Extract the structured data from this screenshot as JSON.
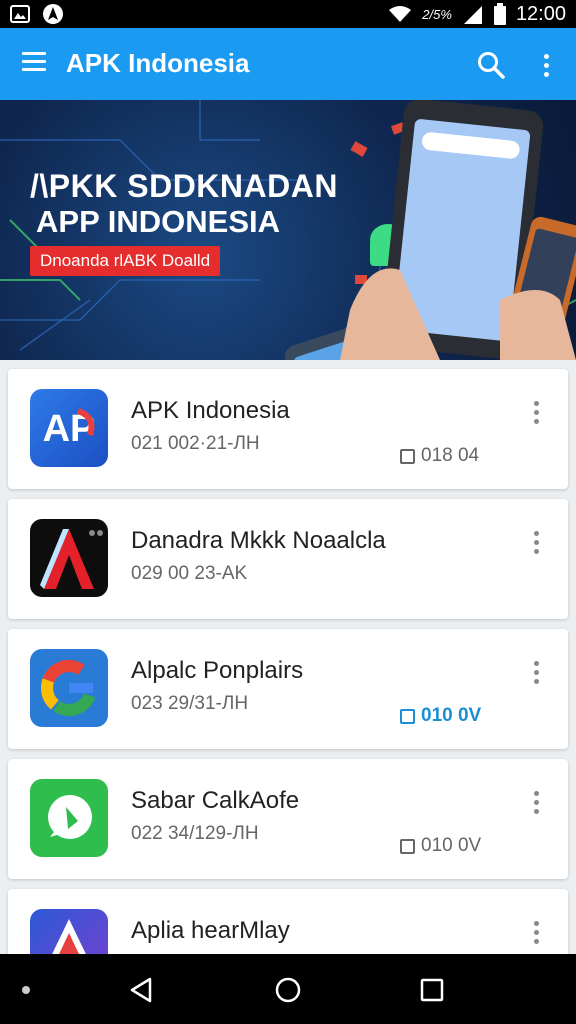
{
  "status_bar": {
    "signal_label": "2/5%",
    "time": "12:00"
  },
  "app_bar": {
    "title": "APK Indonesia"
  },
  "banner": {
    "line1": "/\\PKK SDDKNADAN",
    "line2": "APP INDONESIA",
    "button_label": "Dnoanda rlABK Doalld"
  },
  "apps": [
    {
      "name": "APK Indonesia",
      "meta": "021 002·21-ЛH",
      "size": "018 04",
      "icon": "ap-logo-icon",
      "size_style": "gray"
    },
    {
      "name": "Danadra Mkkk Noaalcla",
      "meta": "029 00 23-AK",
      "size": "",
      "icon": "red-a-logo-icon",
      "size_style": "none"
    },
    {
      "name": "Alpalc Ponplairs",
      "meta": "023 29/31-ЛH",
      "size": "010 0V",
      "icon": "g-logo-icon",
      "size_style": "blue"
    },
    {
      "name": "Sabar CalkAofe",
      "meta": "022 34/129-ЛH",
      "size": "010 0V",
      "icon": "chat-bubble-icon",
      "size_style": "gray"
    },
    {
      "name": "Aplia hearMlay",
      "meta": "",
      "size": "",
      "icon": "triangle-logo-icon",
      "size_style": "none"
    }
  ],
  "colors": {
    "accent": "#1a9af1",
    "banner_button": "#e52d2d",
    "size_blue": "#1a8fd6"
  }
}
